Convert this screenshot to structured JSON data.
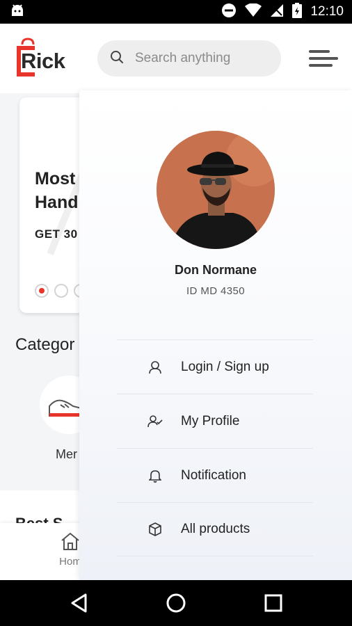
{
  "status_bar": {
    "time": "12:10",
    "icons": [
      "android-icon",
      "do-not-disturb-icon",
      "wifi-icon",
      "signal-icon",
      "battery-icon"
    ]
  },
  "header": {
    "logo_text": "Rick",
    "search_placeholder": "Search anything",
    "brand_color": "#e8352b"
  },
  "banner": {
    "title_line1": "Most",
    "title_line2": "Hand",
    "subtitle": "GET 30",
    "slides": 3,
    "active_slide": 1
  },
  "categories": {
    "title": "Categor",
    "items": [
      {
        "label": "Mer",
        "icon": "sneaker-icon"
      }
    ]
  },
  "best_section": {
    "title": "Best S"
  },
  "bottom_nav": {
    "home_label": "Hom"
  },
  "drawer": {
    "user_name": "Don Normane",
    "user_id": "ID MD 4350",
    "menu": [
      {
        "label": "Login / Sign up",
        "icon": "user-icon"
      },
      {
        "label": "My Profile",
        "icon": "user-check-icon"
      },
      {
        "label": "Notification",
        "icon": "bell-icon"
      },
      {
        "label": "All products",
        "icon": "box-icon"
      }
    ]
  }
}
